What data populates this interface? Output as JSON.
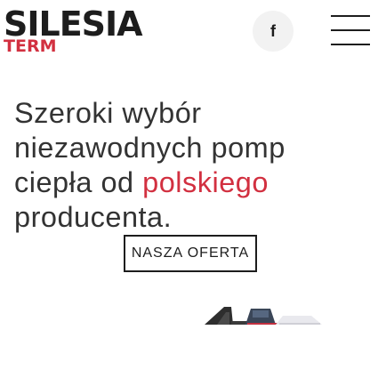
{
  "header": {
    "logo": {
      "main": "SILESIA",
      "sub": "TERM"
    },
    "facebook_label": "f",
    "menu_icon": "hamburger-menu-icon"
  },
  "hero": {
    "text_before": "Szeroki wybór niezawodnych pomp ciepła od ",
    "text_accent": "polskiego",
    "text_after": " producenta."
  },
  "cta": {
    "label": "NASZA OFERTA"
  },
  "colors": {
    "accent": "#d23040",
    "text": "#333333",
    "dark": "#1d1d1d",
    "fb_bg": "#f2f2f2"
  }
}
